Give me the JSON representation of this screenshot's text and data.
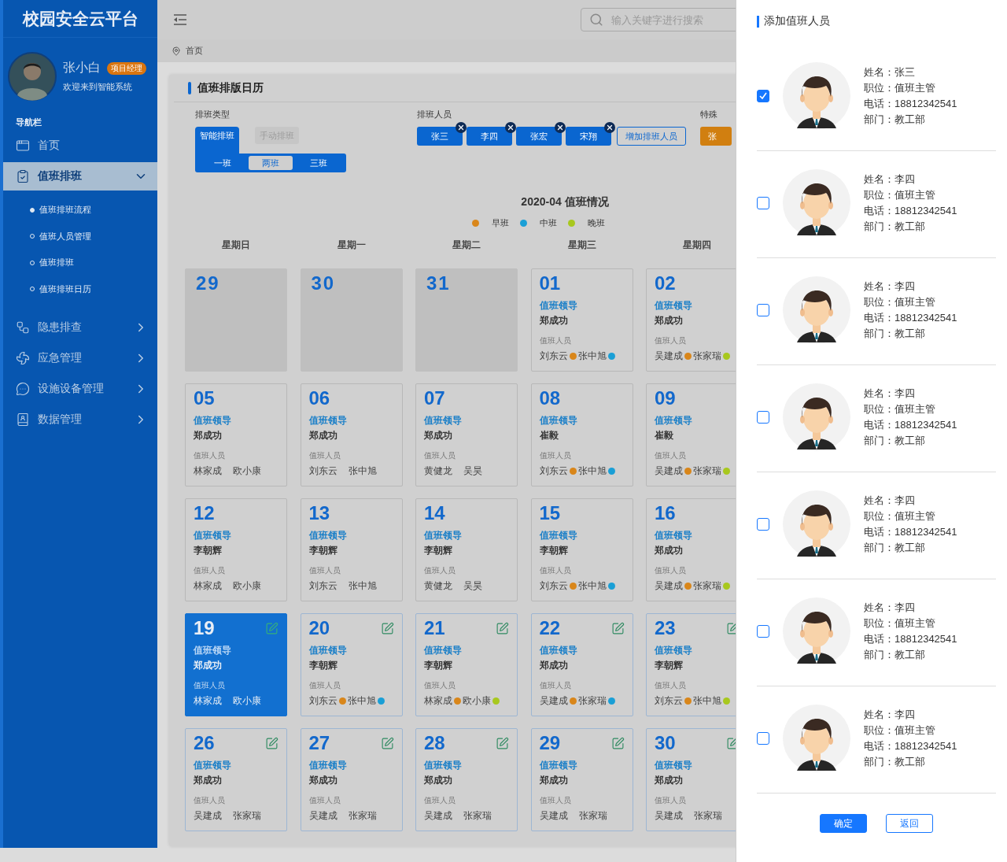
{
  "sidebar": {
    "logo": "校园安全云平台",
    "user": {
      "name": "张小白",
      "badge": "项目经理",
      "greeting": "欢迎来到智能系统"
    },
    "nav_label": "导航栏",
    "items": [
      {
        "label": "首页",
        "kind": "link",
        "selected": false
      },
      {
        "label": "值班排班",
        "kind": "group",
        "selected": true,
        "expanded": true,
        "children": [
          {
            "label": "值班排班流程",
            "selected": true
          },
          {
            "label": "值班人员管理",
            "selected": false
          },
          {
            "label": "值班排班",
            "selected": false
          },
          {
            "label": "值班排班日历",
            "selected": false
          }
        ]
      },
      {
        "label": "隐患排查",
        "kind": "group",
        "selected": false,
        "expanded": false
      },
      {
        "label": "应急管理",
        "kind": "group",
        "selected": false,
        "expanded": false
      },
      {
        "label": "设施设备管理",
        "kind": "group",
        "selected": false,
        "expanded": false
      },
      {
        "label": "数据管理",
        "kind": "group",
        "selected": false,
        "expanded": false
      }
    ]
  },
  "header": {
    "search": {
      "placeholder": "输入关键字进行搜索"
    }
  },
  "breadcrumb": [
    "首页"
  ],
  "card": {
    "title": "值班排版日历",
    "schedule_type": {
      "label": "排班类型",
      "modes": [
        {
          "label": "智能排班",
          "selected": true
        },
        {
          "label": "手动排班",
          "selected": false
        }
      ],
      "shifts": [
        {
          "label": "一班",
          "selected": false
        },
        {
          "label": "两班",
          "selected": true
        },
        {
          "label": "三班",
          "selected": false
        }
      ]
    },
    "staff": {
      "label": "排班人员",
      "tags": [
        "张三",
        "李四",
        "张宏",
        "宋翔"
      ],
      "add_button": "增加排班人员"
    },
    "special": {
      "label": "特殊",
      "tags": [
        "张"
      ]
    },
    "calendar": {
      "title": "2020-04 值班情况",
      "legend": [
        {
          "label": "早班",
          "color": "#d9861a"
        },
        {
          "label": "中班",
          "color": "#1a9fd6"
        },
        {
          "label": "晚班",
          "color": "#a8c81e"
        }
      ],
      "weekdays": [
        "星期日",
        "星期一",
        "星期二",
        "星期三",
        "星期四"
      ],
      "weeks": [
        [
          {
            "day": "29",
            "kind": "other-month",
            "selected": false
          },
          {
            "day": "30",
            "kind": "other-month",
            "selected": false
          },
          {
            "day": "31",
            "kind": "other-month",
            "selected": false
          },
          {
            "day": "01",
            "kind": "day",
            "selected": false,
            "editable": false,
            "leader_label": "值班领导",
            "leader": "郑成功",
            "staff_label": "值班人员",
            "staff": [
              {
                "name": "刘东云",
                "color": "#d9861a"
              },
              {
                "name": "张中旭",
                "color": "#1a9fd6"
              }
            ]
          },
          {
            "day": "02",
            "kind": "day",
            "selected": false,
            "editable": false,
            "leader_label": "值班领导",
            "leader": "郑成功",
            "staff_label": "值班人员",
            "staff": [
              {
                "name": "吴建成",
                "color": "#d9861a"
              },
              {
                "name": "张家瑞",
                "color": "#a8c81e"
              }
            ]
          }
        ],
        [
          {
            "day": "05",
            "kind": "day",
            "selected": false,
            "editable": false,
            "leader_label": "值班领导",
            "leader": "郑成功",
            "staff_label": "值班人员",
            "staff": [
              {
                "name": "林家成"
              },
              {
                "name": "欧小康"
              }
            ]
          },
          {
            "day": "06",
            "kind": "day",
            "selected": false,
            "editable": false,
            "leader_label": "值班领导",
            "leader": "郑成功",
            "staff_label": "值班人员",
            "staff": [
              {
                "name": "刘东云"
              },
              {
                "name": "张中旭"
              }
            ]
          },
          {
            "day": "07",
            "kind": "day",
            "selected": false,
            "editable": false,
            "leader_label": "值班领导",
            "leader": "郑成功",
            "staff_label": "值班人员",
            "staff": [
              {
                "name": "黄健龙"
              },
              {
                "name": "吴昊"
              }
            ]
          },
          {
            "day": "08",
            "kind": "day",
            "selected": false,
            "editable": false,
            "leader_label": "值班领导",
            "leader": "崔毅",
            "staff_label": "值班人员",
            "staff": [
              {
                "name": "刘东云",
                "color": "#d9861a"
              },
              {
                "name": "张中旭",
                "color": "#1a9fd6"
              }
            ]
          },
          {
            "day": "09",
            "kind": "day",
            "selected": false,
            "editable": false,
            "leader_label": "值班领导",
            "leader": "崔毅",
            "staff_label": "值班人员",
            "staff": [
              {
                "name": "吴建成",
                "color": "#d9861a"
              },
              {
                "name": "张家瑞",
                "color": "#a8c81e"
              }
            ]
          }
        ],
        [
          {
            "day": "12",
            "kind": "day",
            "selected": false,
            "editable": false,
            "leader_label": "值班领导",
            "leader": "李朝辉",
            "staff_label": "值班人员",
            "staff": [
              {
                "name": "林家成"
              },
              {
                "name": "欧小康"
              }
            ]
          },
          {
            "day": "13",
            "kind": "day",
            "selected": false,
            "editable": false,
            "leader_label": "值班领导",
            "leader": "李朝辉",
            "staff_label": "值班人员",
            "staff": [
              {
                "name": "刘东云"
              },
              {
                "name": "张中旭"
              }
            ]
          },
          {
            "day": "14",
            "kind": "day",
            "selected": false,
            "editable": false,
            "leader_label": "值班领导",
            "leader": "李朝辉",
            "staff_label": "值班人员",
            "staff": [
              {
                "name": "黄健龙"
              },
              {
                "name": "吴昊"
              }
            ]
          },
          {
            "day": "15",
            "kind": "day",
            "selected": false,
            "editable": false,
            "leader_label": "值班领导",
            "leader": "李朝辉",
            "staff_label": "值班人员",
            "staff": [
              {
                "name": "刘东云",
                "color": "#d9861a"
              },
              {
                "name": "张中旭",
                "color": "#1a9fd6"
              }
            ]
          },
          {
            "day": "16",
            "kind": "day",
            "selected": false,
            "editable": false,
            "leader_label": "值班领导",
            "leader": "郑成功",
            "staff_label": "值班人员",
            "staff": [
              {
                "name": "吴建成",
                "color": "#d9861a"
              },
              {
                "name": "张家瑞",
                "color": "#a8c81e"
              }
            ]
          }
        ],
        [
          {
            "day": "19",
            "kind": "day",
            "selected": true,
            "editable": true,
            "leader_label": "值班领导",
            "leader": "郑成功",
            "staff_label": "值班人员",
            "staff": [
              {
                "name": "林家成"
              },
              {
                "name": "欧小康"
              }
            ]
          },
          {
            "day": "20",
            "kind": "day",
            "selected": false,
            "editable": true,
            "leader_label": "值班领导",
            "leader": "李朝辉",
            "staff_label": "值班人员",
            "staff": [
              {
                "name": "刘东云",
                "color": "#d9861a"
              },
              {
                "name": "张中旭",
                "color": "#1a9fd6"
              }
            ]
          },
          {
            "day": "21",
            "kind": "day",
            "selected": false,
            "editable": true,
            "leader_label": "值班领导",
            "leader": "李朝辉",
            "staff_label": "值班人员",
            "staff": [
              {
                "name": "林家成",
                "color": "#d9861a"
              },
              {
                "name": "欧小康",
                "color": "#a8c81e"
              }
            ]
          },
          {
            "day": "22",
            "kind": "day",
            "selected": false,
            "editable": true,
            "leader_label": "值班领导",
            "leader": "郑成功",
            "staff_label": "值班人员",
            "staff": [
              {
                "name": "吴建成",
                "color": "#d9861a"
              },
              {
                "name": "张家瑞",
                "color": "#1a9fd6"
              }
            ]
          },
          {
            "day": "23",
            "kind": "day",
            "selected": false,
            "editable": true,
            "leader_label": "值班领导",
            "leader": "李朝辉",
            "staff_label": "值班人员",
            "staff": [
              {
                "name": "刘东云",
                "color": "#d9861a"
              },
              {
                "name": "张中旭",
                "color": "#a8c81e"
              }
            ]
          }
        ],
        [
          {
            "day": "26",
            "kind": "day",
            "selected": false,
            "editable": true,
            "leader_label": "值班领导",
            "leader": "郑成功",
            "staff_label": "值班人员",
            "staff": [
              {
                "name": "吴建成"
              },
              {
                "name": "张家瑞"
              }
            ]
          },
          {
            "day": "27",
            "kind": "day",
            "selected": false,
            "editable": true,
            "leader_label": "值班领导",
            "leader": "郑成功",
            "staff_label": "值班人员",
            "staff": [
              {
                "name": "吴建成"
              },
              {
                "name": "张家瑞"
              }
            ]
          },
          {
            "day": "28",
            "kind": "day",
            "selected": false,
            "editable": true,
            "leader_label": "值班领导",
            "leader": "郑成功",
            "staff_label": "值班人员",
            "staff": [
              {
                "name": "吴建成"
              },
              {
                "name": "张家瑞"
              }
            ]
          },
          {
            "day": "29",
            "kind": "day",
            "selected": false,
            "editable": true,
            "leader_label": "值班领导",
            "leader": "郑成功",
            "staff_label": "值班人员",
            "staff": [
              {
                "name": "吴建成"
              },
              {
                "name": "张家瑞"
              }
            ]
          },
          {
            "day": "30",
            "kind": "day",
            "selected": false,
            "editable": true,
            "leader_label": "值班领导",
            "leader": "郑成功",
            "staff_label": "值班人员",
            "staff": [
              {
                "name": "吴建成"
              },
              {
                "name": "张家瑞"
              }
            ]
          }
        ]
      ]
    }
  },
  "panel": {
    "title": "添加值班人员",
    "people": [
      {
        "checked": true,
        "lines": [
          "姓名：张三",
          "职位：值班主管",
          "电话：18812342541",
          "部门：教工部"
        ]
      },
      {
        "checked": false,
        "lines": [
          "姓名：李四",
          "职位：值班主管",
          "电话：18812342541",
          "部门：教工部"
        ]
      },
      {
        "checked": false,
        "lines": [
          "姓名：李四",
          "职位：值班主管",
          "电话：18812342541",
          "部门：教工部"
        ]
      },
      {
        "checked": false,
        "lines": [
          "姓名：李四",
          "职位：值班主管",
          "电话：18812342541",
          "部门：教工部"
        ]
      },
      {
        "checked": false,
        "lines": [
          "姓名：李四",
          "职位：值班主管",
          "电话：18812342541",
          "部门：教工部"
        ]
      },
      {
        "checked": false,
        "lines": [
          "姓名：李四",
          "职位：值班主管",
          "电话：18812342541",
          "部门：教工部"
        ]
      },
      {
        "checked": false,
        "lines": [
          "姓名：李四",
          "职位：值班主管",
          "电话：18812342541",
          "部门：教工部"
        ]
      }
    ],
    "buttons": [
      {
        "label": "确定",
        "kind": "primary"
      },
      {
        "label": "返回",
        "kind": "secondary"
      }
    ]
  }
}
